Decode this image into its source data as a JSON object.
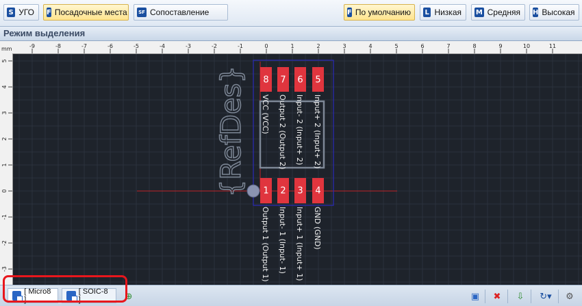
{
  "toolbar": {
    "left_buttons": [
      {
        "icon_letter": "S",
        "label": "УГО",
        "active": false
      },
      {
        "icon_letter": "F",
        "label": "Посадочные места",
        "active": true
      },
      {
        "icon_letter": "SF",
        "label": "Сопоставление",
        "active": false
      }
    ],
    "right_buttons": [
      {
        "icon_letter": "F",
        "label": "По умолчанию",
        "active": true
      },
      {
        "icon_letter": "L",
        "label": "Низкая",
        "active": false
      },
      {
        "icon_letter": "M",
        "label": "Средняя",
        "active": false
      },
      {
        "icon_letter": "H",
        "label": "Высокая",
        "active": false
      }
    ]
  },
  "mode_title": "Режим выделения",
  "ruler": {
    "unit": "mm",
    "x_ticks": [
      -9,
      -8,
      -7,
      -6,
      -5,
      -4,
      -3,
      -2,
      -1,
      0,
      1,
      2,
      3,
      4,
      5,
      6,
      7,
      8,
      9,
      10,
      11
    ],
    "y_ticks": [
      5,
      4,
      3,
      2,
      1,
      0,
      -1,
      -2,
      -3
    ]
  },
  "footprint": {
    "refdes": "{RefDes}",
    "top_pads": [
      {
        "number": "8",
        "label": "VCC (VCC)"
      },
      {
        "number": "7",
        "label": "Output 2 (Output 2)"
      },
      {
        "number": "6",
        "label": "Input- 2 (Input+ 2)"
      },
      {
        "number": "5",
        "label": "Input+ 2 (Input+ 2)"
      }
    ],
    "bottom_pads": [
      {
        "number": "1",
        "label": "Output 1 (Output 1)"
      },
      {
        "number": "2",
        "label": "Input- 1 (Input- 1)"
      },
      {
        "number": "3",
        "label": "Input+ 1 (Input+ 1)"
      },
      {
        "number": "4",
        "label": "GND (GND)"
      }
    ]
  },
  "tabs": [
    {
      "label": "[ Micro8 ]",
      "active": true
    },
    {
      "label": "[ SOIC-8 ]",
      "active": false
    }
  ],
  "status_icons": [
    "add-footprint-icon",
    "page-icon",
    "delete-icon",
    "export-icon",
    "rotate-icon",
    "gear-icon"
  ],
  "colors": {
    "canvas_bg": "#1e232b",
    "pad": "#e0353e",
    "outline": "#2a2ab8",
    "origin_line": "#c0232a",
    "highlight": "#e8161c",
    "active_button": "#ffe48e"
  }
}
